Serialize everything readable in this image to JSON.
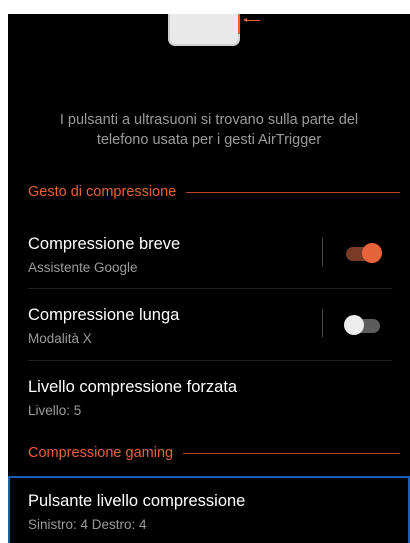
{
  "colors": {
    "accent": "#e8623a",
    "background": "#000000",
    "focus_outline": "#1a5fb4"
  },
  "info": {
    "text": "I pulsanti a ultrasuoni si trovano sulla parte del telefono usata per i gesti AirTrigger"
  },
  "sections": {
    "squeeze": {
      "title": "Gesto di compressione",
      "rows": {
        "short": {
          "title": "Compressione breve",
          "subtitle": "Assistente Google",
          "toggle": "on"
        },
        "long": {
          "title": "Compressione lunga",
          "subtitle": "Modalità X",
          "toggle": "off"
        },
        "force": {
          "title": "Livello compressione forzata",
          "subtitle": "Livello: 5"
        }
      }
    },
    "gaming": {
      "title": "Compressione gaming",
      "rows": {
        "button_level": {
          "title": "Pulsante livello compressione",
          "subtitle": "Sinistro: 4 Destro: 4"
        }
      }
    }
  }
}
